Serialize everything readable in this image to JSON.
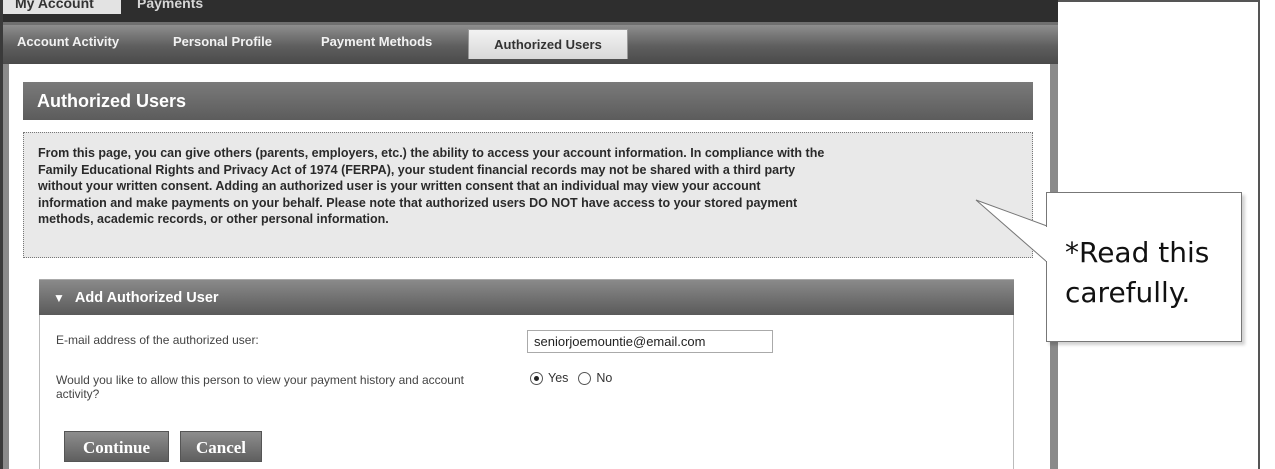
{
  "top_nav": {
    "tabs": [
      {
        "label": "My Account",
        "active": true
      },
      {
        "label": "Payments",
        "active": false
      }
    ]
  },
  "sub_nav": {
    "tabs": [
      {
        "label": "Account Activity"
      },
      {
        "label": "Personal Profile"
      },
      {
        "label": "Payment Methods"
      },
      {
        "label": "Authorized Users",
        "active": true
      }
    ]
  },
  "page": {
    "title": "Authorized Users",
    "notice_lines": [
      "From this page, you can give others (parents, employers, etc.) the ability to access your account information. In compliance with the",
      "Family Educational Rights and Privacy Act of 1974 (FERPA), your student financial records may not be shared with a third party",
      "without your written consent. Adding an authorized user is your written consent that an individual may view your account",
      "information and make payments on your behalf. Please note that authorized users DO NOT have access to your stored payment",
      "methods, academic records, or other personal information."
    ]
  },
  "form": {
    "section_title": "Add Authorized User",
    "email_label": "E-mail address of the authorized user:",
    "email_value": "seniorjoemountie@email.com",
    "view_label": "Would you like to allow this person to view your payment history and account activity?",
    "options": [
      {
        "label": "Yes",
        "checked": true
      },
      {
        "label": "No",
        "checked": false
      }
    ],
    "continue_label": "Continue",
    "cancel_label": "Cancel"
  },
  "callout": {
    "line1": "*Read this",
    "line2": "carefully."
  },
  "colors": {
    "header_gray": "#6a6a6a",
    "nav_dark": "#2e2e2e",
    "notice_bg": "#e9e9e9"
  }
}
